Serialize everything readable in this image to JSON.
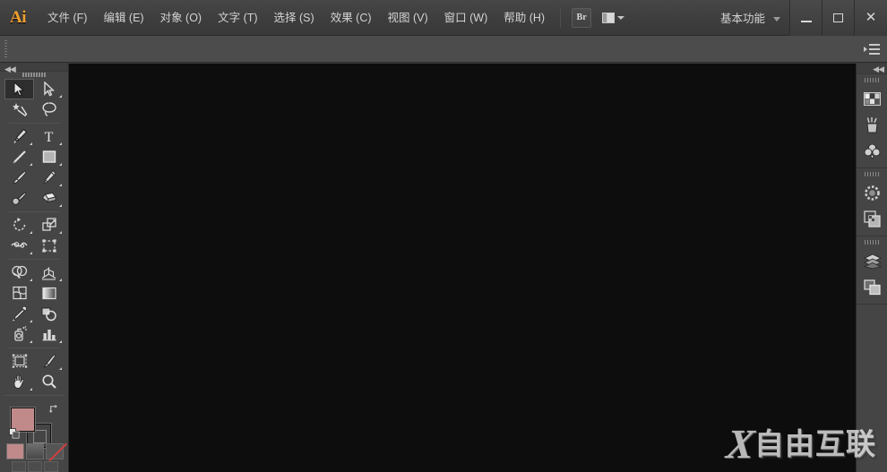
{
  "app": {
    "name": "Ai",
    "logo_color": "#f0a030"
  },
  "menubar": {
    "items": [
      {
        "label": "文件 (F)",
        "name": "menu-file"
      },
      {
        "label": "编辑 (E)",
        "name": "menu-edit"
      },
      {
        "label": "对象 (O)",
        "name": "menu-object"
      },
      {
        "label": "文字 (T)",
        "name": "menu-type"
      },
      {
        "label": "选择 (S)",
        "name": "menu-select"
      },
      {
        "label": "效果 (C)",
        "name": "menu-effect"
      },
      {
        "label": "视图 (V)",
        "name": "menu-view"
      },
      {
        "label": "窗口 (W)",
        "name": "menu-window"
      },
      {
        "label": "帮助 (H)",
        "name": "menu-help"
      }
    ],
    "bridge_label": "Br",
    "arrange_tooltip": "排列文档",
    "workspace": "基本功能",
    "window_controls": {
      "minimize": "－",
      "maximize": "□",
      "close": "✕"
    }
  },
  "toolbar": {
    "collapse_label": "◀◀",
    "tools": [
      {
        "name": "selection-tool",
        "label": "选择工具",
        "active": true,
        "has_flyout": false
      },
      {
        "name": "direct-selection-tool",
        "label": "直接选择工具",
        "active": false,
        "has_flyout": true
      },
      {
        "name": "magic-wand-tool",
        "label": "魔棒工具",
        "active": false,
        "has_flyout": false
      },
      {
        "name": "lasso-tool",
        "label": "套索工具",
        "active": false,
        "has_flyout": false
      },
      {
        "name": "pen-tool",
        "label": "钢笔工具",
        "active": false,
        "has_flyout": true
      },
      {
        "name": "type-tool",
        "label": "文字工具",
        "active": false,
        "has_flyout": true
      },
      {
        "name": "line-segment-tool",
        "label": "直线段工具",
        "active": false,
        "has_flyout": true
      },
      {
        "name": "rectangle-tool",
        "label": "矩形工具",
        "active": false,
        "has_flyout": true
      },
      {
        "name": "paintbrush-tool",
        "label": "画笔工具",
        "active": false,
        "has_flyout": false
      },
      {
        "name": "pencil-tool",
        "label": "铅笔工具",
        "active": false,
        "has_flyout": true
      },
      {
        "name": "blob-brush-tool",
        "label": "斑点画笔工具",
        "active": false,
        "has_flyout": false
      },
      {
        "name": "eraser-tool",
        "label": "橡皮擦工具",
        "active": false,
        "has_flyout": true
      },
      {
        "name": "rotate-tool",
        "label": "旋转工具",
        "active": false,
        "has_flyout": true
      },
      {
        "name": "scale-tool",
        "label": "比例缩放工具",
        "active": false,
        "has_flyout": true
      },
      {
        "name": "width-tool",
        "label": "宽度工具",
        "active": false,
        "has_flyout": true
      },
      {
        "name": "free-transform-tool",
        "label": "自由变换工具",
        "active": false,
        "has_flyout": false
      },
      {
        "name": "shape-builder-tool",
        "label": "形状生成器工具",
        "active": false,
        "has_flyout": true
      },
      {
        "name": "perspective-grid-tool",
        "label": "透视网格工具",
        "active": false,
        "has_flyout": true
      },
      {
        "name": "mesh-tool",
        "label": "网格工具",
        "active": false,
        "has_flyout": false
      },
      {
        "name": "gradient-tool",
        "label": "渐变工具",
        "active": false,
        "has_flyout": false
      },
      {
        "name": "eyedropper-tool",
        "label": "吸管工具",
        "active": false,
        "has_flyout": true
      },
      {
        "name": "blend-tool",
        "label": "混合工具",
        "active": false,
        "has_flyout": false
      },
      {
        "name": "symbol-sprayer-tool",
        "label": "符号喷枪工具",
        "active": false,
        "has_flyout": true
      },
      {
        "name": "column-graph-tool",
        "label": "柱形图工具",
        "active": false,
        "has_flyout": true
      },
      {
        "name": "artboard-tool",
        "label": "画板工具",
        "active": false,
        "has_flyout": false
      },
      {
        "name": "slice-tool",
        "label": "切片工具",
        "active": false,
        "has_flyout": true
      },
      {
        "name": "hand-tool",
        "label": "抓手工具",
        "active": false,
        "has_flyout": true
      },
      {
        "name": "zoom-tool",
        "label": "缩放工具",
        "active": false,
        "has_flyout": false
      }
    ],
    "fill_color": "#c08a8a",
    "stroke_color": "#454545",
    "color_modes": [
      {
        "name": "color-mode-button",
        "label": "颜色"
      },
      {
        "name": "gradient-mode-button",
        "label": "渐变"
      },
      {
        "name": "none-mode-button",
        "label": "无"
      }
    ],
    "screen_modes": [
      {
        "name": "normal-screen-mode-button",
        "label": "正常屏幕模式"
      },
      {
        "name": "fullscreen-menu-mode-button",
        "label": "带有菜单栏的全屏模式"
      },
      {
        "name": "fullscreen-mode-button",
        "label": "全屏模式"
      }
    ]
  },
  "rightdock": {
    "collapse_label": "◀◀",
    "groups": [
      {
        "panels": [
          {
            "name": "swatches-panel-icon",
            "label": "色板"
          },
          {
            "name": "brushes-panel-icon",
            "label": "画笔"
          },
          {
            "name": "symbols-panel-icon",
            "label": "符号"
          }
        ]
      },
      {
        "panels": [
          {
            "name": "stroke-panel-icon",
            "label": "描边"
          },
          {
            "name": "transparency-panel-icon",
            "label": "透明度"
          }
        ]
      },
      {
        "panels": [
          {
            "name": "layers-panel-icon",
            "label": "图层"
          },
          {
            "name": "artboards-panel-icon",
            "label": "画板"
          }
        ]
      }
    ]
  },
  "canvas": {
    "background": "#0d0d0d",
    "document_open": false
  },
  "watermark": {
    "mark": "X",
    "text": "自由互联"
  }
}
